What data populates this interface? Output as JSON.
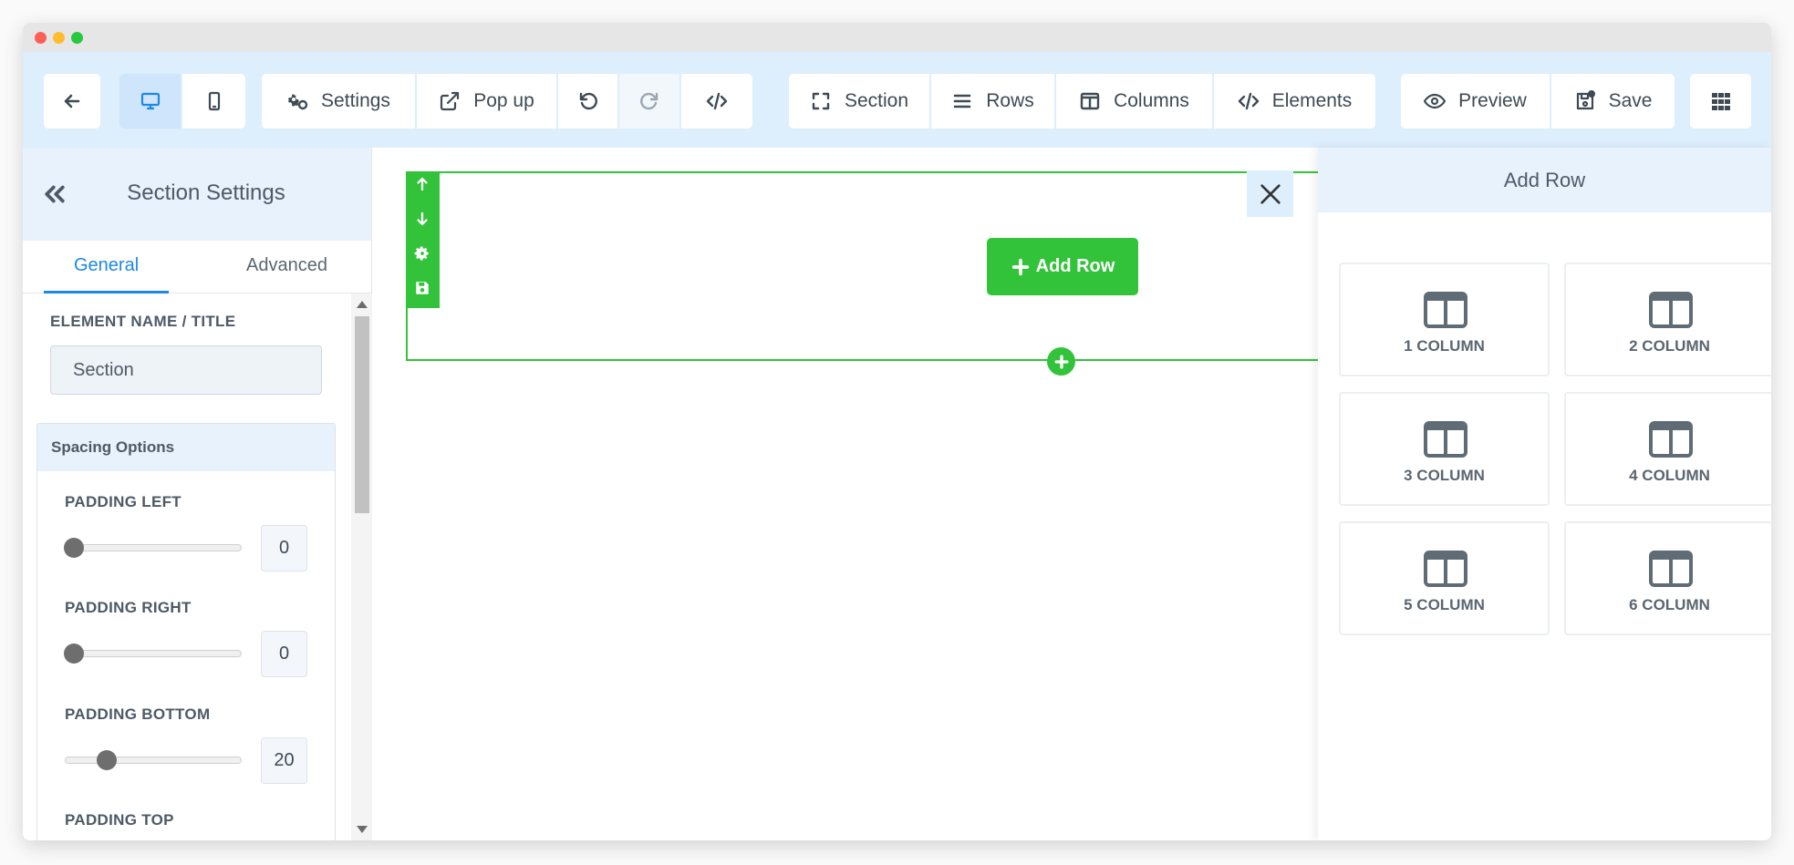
{
  "window": {
    "title": ""
  },
  "toolbar": {
    "settings_label": "Settings",
    "popup_label": "Pop up",
    "section_label": "Section",
    "rows_label": "Rows",
    "columns_label": "Columns",
    "elements_label": "Elements",
    "preview_label": "Preview",
    "save_label": "Save"
  },
  "sidebar": {
    "title": "Section Settings",
    "tabs": {
      "general": "General",
      "advanced": "Advanced"
    },
    "element_name_label": "ELEMENT NAME / TITLE",
    "element_name_value": "Section",
    "spacing_title": "Spacing Options",
    "padding_left_label": "PADDING LEFT",
    "padding_left_value": "0",
    "padding_right_label": "PADDING RIGHT",
    "padding_right_value": "0",
    "padding_bottom_label": "PADDING BOTTOM",
    "padding_bottom_value": "20",
    "padding_top_label": "PADDING TOP"
  },
  "canvas": {
    "add_row_label": "Add Row"
  },
  "add_row_panel": {
    "title": "Add Row",
    "options": [
      "1 COLUMN",
      "2 COLUMN",
      "3 COLUMN",
      "4 COLUMN",
      "5 COLUMN",
      "6 COLUMN"
    ]
  },
  "colors": {
    "accent_blue": "#1e88e5",
    "toolbar_bg": "#ddeefc",
    "green": "#33c33a"
  }
}
